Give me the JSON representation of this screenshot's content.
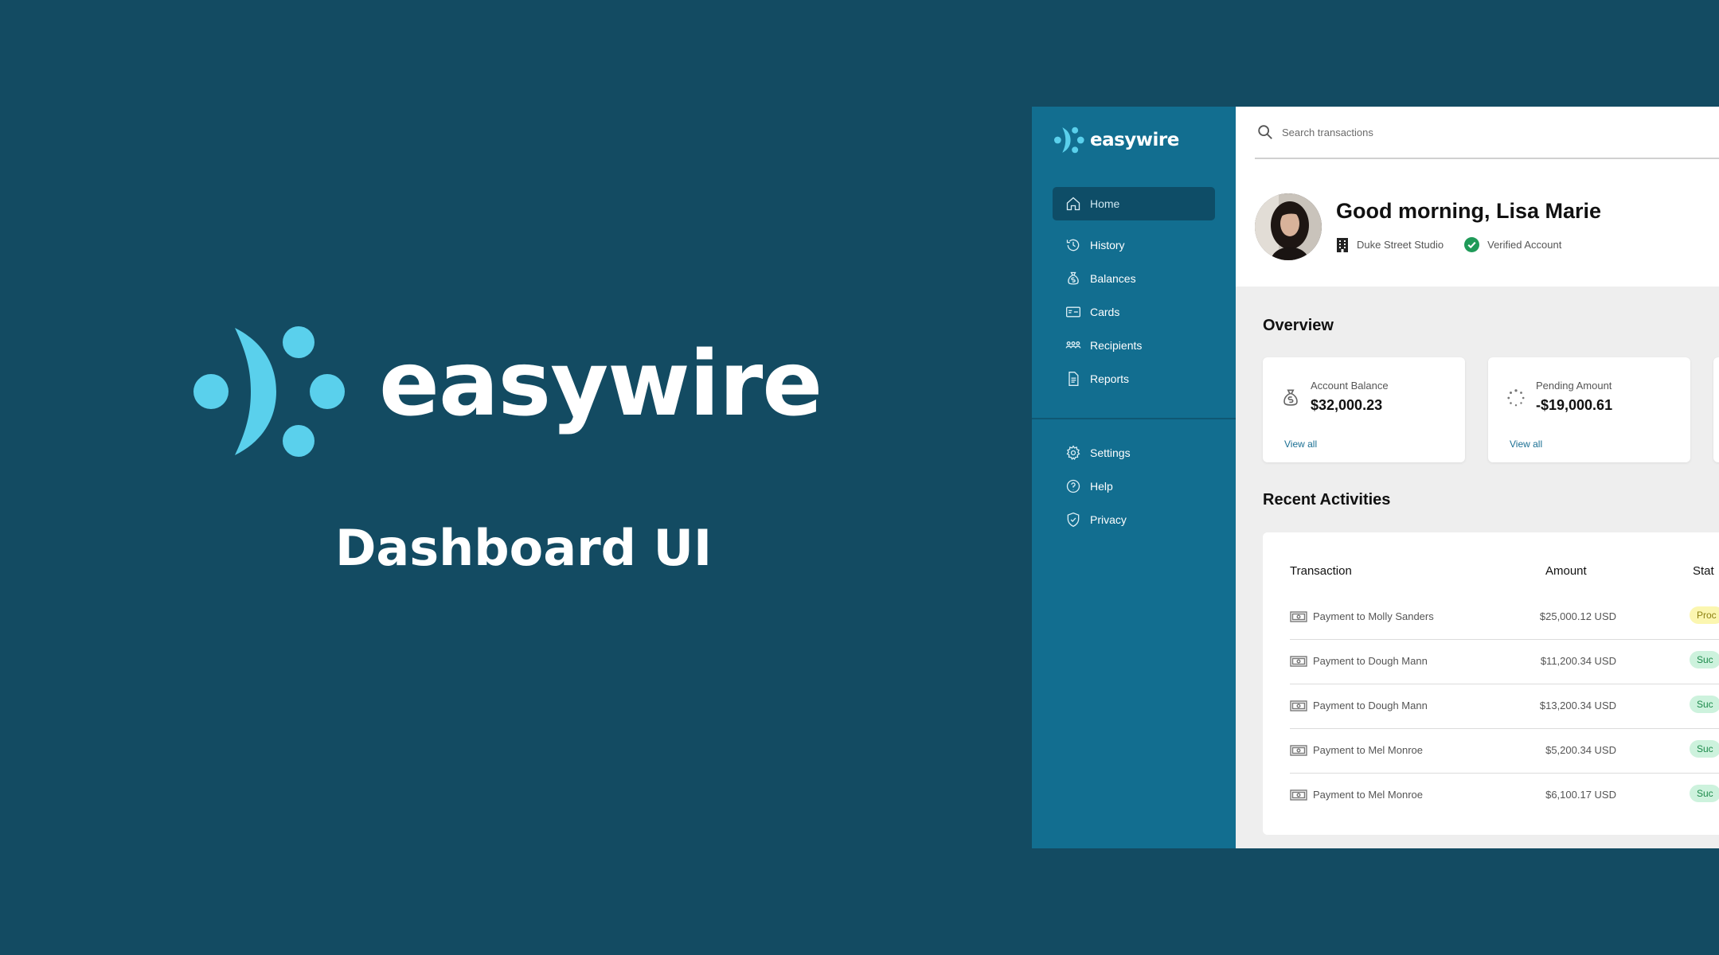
{
  "hero": {
    "logo_text": "easywire",
    "subtitle": "Dashboard UI"
  },
  "brand": {
    "name": "easywire",
    "accent_color": "#5ad0ec"
  },
  "sidebar": {
    "items": [
      {
        "label": "Home",
        "icon": "home-icon",
        "active": true
      },
      {
        "label": "History",
        "icon": "history-icon",
        "active": false
      },
      {
        "label": "Balances",
        "icon": "money-bag-icon",
        "active": false
      },
      {
        "label": "Cards",
        "icon": "credit-card-icon",
        "active": false
      },
      {
        "label": "Recipients",
        "icon": "users-icon",
        "active": false
      },
      {
        "label": "Reports",
        "icon": "document-icon",
        "active": false
      }
    ],
    "secondary_items": [
      {
        "label": "Settings",
        "icon": "gear-icon"
      },
      {
        "label": "Help",
        "icon": "question-icon"
      },
      {
        "label": "Privacy",
        "icon": "shield-icon"
      }
    ]
  },
  "search": {
    "placeholder": "Search transactions"
  },
  "profile": {
    "greeting": "Good morning, Lisa Marie",
    "company": "Duke Street Studio",
    "status": "Verified Account"
  },
  "overview": {
    "title": "Overview",
    "cards": [
      {
        "label": "Account Balance",
        "value": "$32,000.23",
        "link": "View all",
        "icon": "money-bag-icon"
      },
      {
        "label": "Pending Amount",
        "value": "-$19,000.61",
        "link": "View all",
        "icon": "loading-icon"
      }
    ]
  },
  "activities": {
    "title": "Recent Activities",
    "headers": {
      "transaction": "Transaction",
      "amount": "Amount",
      "status": "Stat"
    },
    "rows": [
      {
        "name": "Payment to Molly Sanders",
        "amount": "$25,000.12 USD",
        "status": "Proc",
        "status_type": "processing"
      },
      {
        "name": "Payment to Dough Mann",
        "amount": "$11,200.34 USD",
        "status": "Suc",
        "status_type": "success"
      },
      {
        "name": "Payment to Dough Mann",
        "amount": "$13,200.34 USD",
        "status": "Suc",
        "status_type": "success"
      },
      {
        "name": "Payment to Mel Monroe",
        "amount": "$5,200.34 USD",
        "status": "Suc",
        "status_type": "success"
      },
      {
        "name": "Payment to Mel Monroe",
        "amount": "$6,100.17 USD",
        "status": "Suc",
        "status_type": "success"
      }
    ]
  },
  "colors": {
    "background": "#134b62",
    "sidebar": "#126e90",
    "sidebar_active": "#0e4d67",
    "processing": "#fbf6b0",
    "success": "#cdf2dd"
  }
}
